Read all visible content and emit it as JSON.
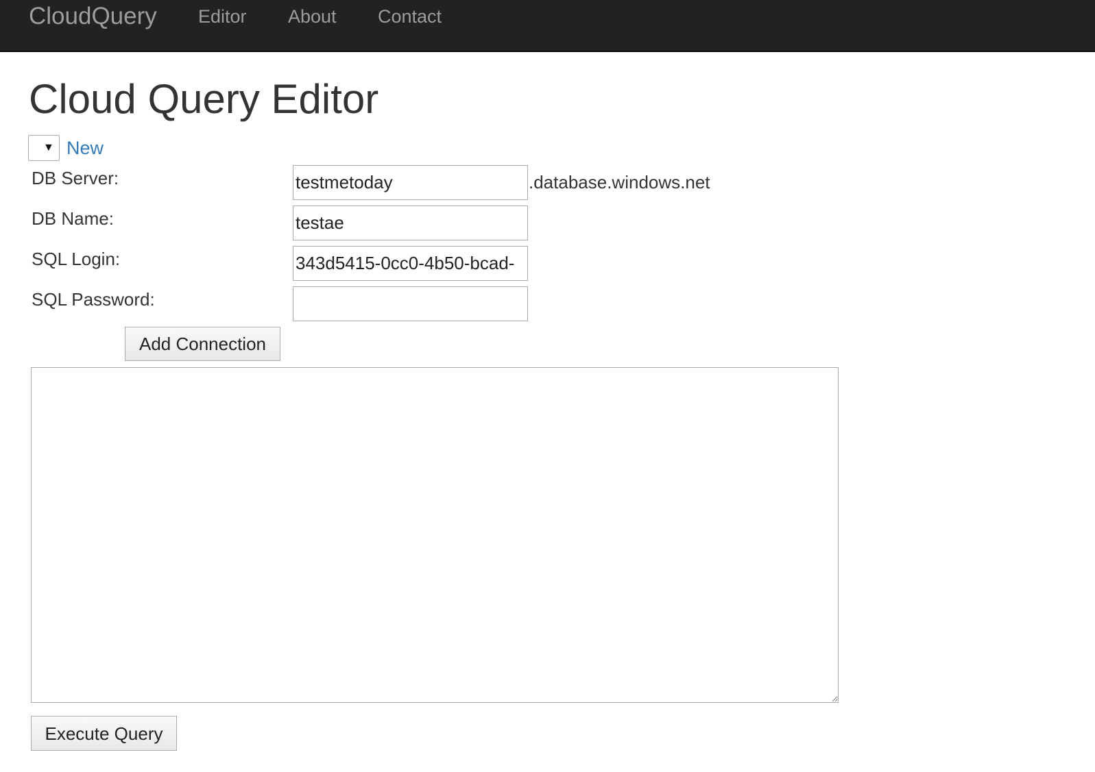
{
  "navbar": {
    "brand": "CloudQuery",
    "links": [
      {
        "label": "Editor"
      },
      {
        "label": "About"
      },
      {
        "label": "Contact"
      }
    ],
    "background_color": "#222222",
    "link_color": "#9d9d9d"
  },
  "page": {
    "title": "Cloud Query Editor"
  },
  "connection": {
    "selector_icon": "triangle-down-icon",
    "selected_value": "",
    "new_link_label": "New",
    "link_color": "#337ab7"
  },
  "form": {
    "db_server": {
      "label": "DB Server:",
      "value": "testmetoday",
      "suffix": ".database.windows.net"
    },
    "db_name": {
      "label": "DB Name:",
      "value": "testae"
    },
    "sql_login": {
      "label": "SQL Login:",
      "value": "343d5415-0cc0-4b50-bcad-"
    },
    "sql_password": {
      "label": "SQL Password:",
      "value": ""
    },
    "add_connection_label": "Add Connection"
  },
  "query": {
    "text": "",
    "execute_label": "Execute Query"
  }
}
